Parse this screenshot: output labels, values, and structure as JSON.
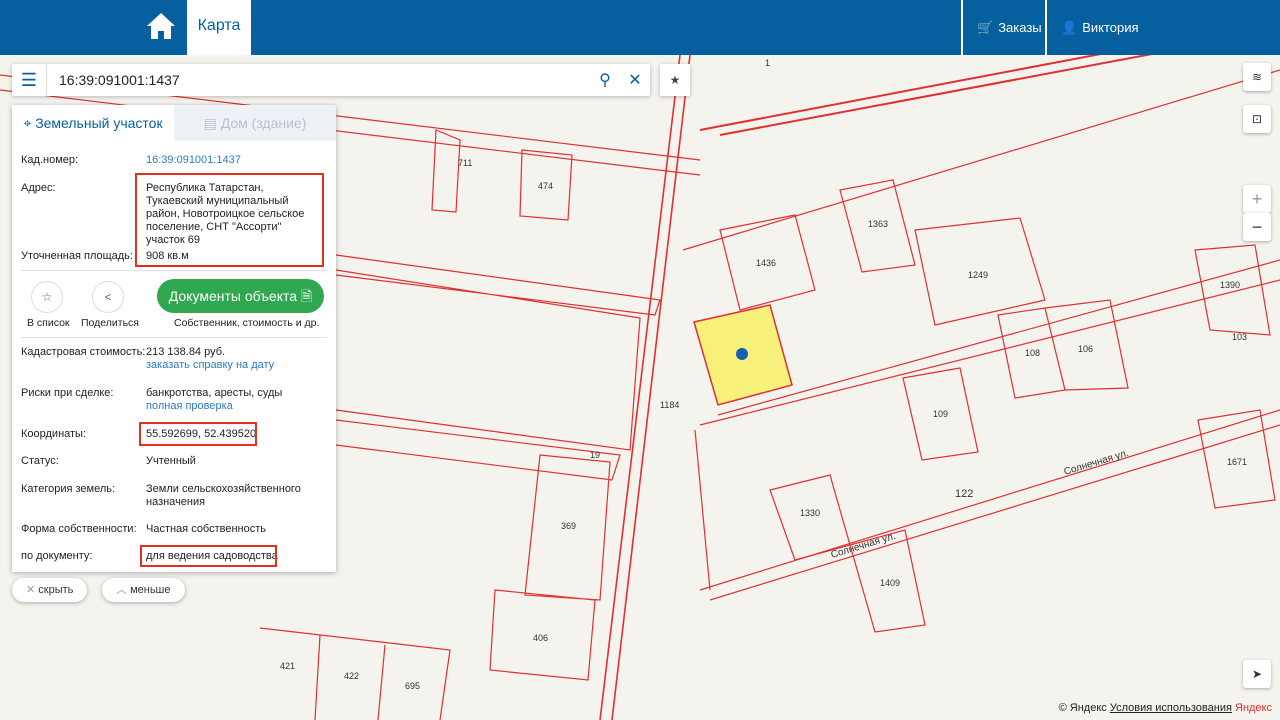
{
  "header": {
    "tab_label": "Карта",
    "orders_label": "Заказы",
    "user_label": "Виктория"
  },
  "search": {
    "value": "16:39:091001:1437"
  },
  "panel": {
    "tabs": [
      "Земельный участок",
      "Дом (здание)"
    ],
    "cad_label": "Кад.номер:",
    "cad_value": "16:39:091001:1437",
    "addr_label": "Адрес:",
    "addr_value": "Республика Татарстан, Тукаевский муниципальный район, Новотроицкое сельское поселение, СНТ \"Ассорти\" участок 69",
    "area_label": "Уточненная площадь:",
    "area_value": "908 кв.м",
    "fav_label": "В список",
    "share_label": "Поделиться",
    "docs_label": "Документы объекта",
    "docs_sub": "Собственник, стоимость и др.",
    "cost_label": "Кадастровая стоимость:",
    "cost_value": "213 138.84 руб.",
    "cost_link": "заказать справку на дату",
    "risk_label": "Риски при сделке:",
    "risk_value": "банкротства, аресты, суды",
    "risk_link": "полная проверка",
    "coord_label": "Координаты:",
    "coord_value": "55.592699, 52.439520",
    "status_label": "Статус:",
    "status_value": "Учтенный",
    "cat_label": "Категория земель:",
    "cat_value": "Земли сельскохозяйственного назначения",
    "own_label": "Форма собственности:",
    "own_value": "Частная собственность",
    "doc_label": "по документу:",
    "doc_value": "для ведения садоводства"
  },
  "buttons": {
    "hide": "скрыть",
    "less": "меньше"
  },
  "map_labels": [
    "711",
    "474",
    "1363",
    "1436",
    "1249",
    "1390",
    "103",
    "108",
    "106",
    "109",
    "1184",
    "1671",
    "122",
    "1330",
    "1409",
    "369",
    "406",
    "421",
    "422",
    "695",
    "19",
    "1",
    "Солнечная ул.",
    "Солнечная ул."
  ],
  "footer": {
    "copy": "© Яндекс",
    "terms": "Условия использования",
    "logo": "Яндекс"
  },
  "colors": {
    "brand": "#0660a0",
    "boundary": "#e03030",
    "selected": "#f7f07a",
    "green": "#2fa84f"
  }
}
